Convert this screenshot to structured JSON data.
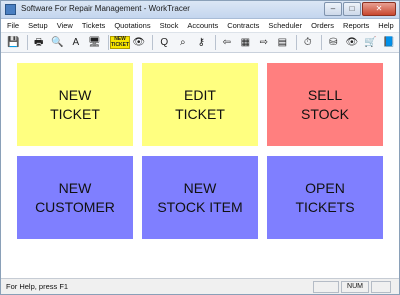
{
  "window": {
    "title": "Software For Repair Management - WorkTracer",
    "min_glyph": "–",
    "max_glyph": "□",
    "close_glyph": "✕"
  },
  "menu": [
    {
      "label": "File"
    },
    {
      "label": "Setup"
    },
    {
      "label": "View"
    },
    {
      "label": "Tickets"
    },
    {
      "label": "Quotations"
    },
    {
      "label": "Stock"
    },
    {
      "label": "Accounts"
    },
    {
      "label": "Contracts"
    },
    {
      "label": "Scheduler"
    },
    {
      "label": "Orders"
    },
    {
      "label": "Reports"
    },
    {
      "label": "Help"
    }
  ],
  "toolbar": {
    "save_glyph": "💾",
    "print_glyph": "🖶",
    "preview_glyph": "🔍",
    "font_glyph": "A",
    "screen_glyph": "🖥",
    "new_ticket_label": "NEW TICKET",
    "binoculars_glyph": "👁",
    "find_glyph": "Q",
    "search_glyph": "⌕",
    "key_glyph": "⚷",
    "back_glyph": "⇦",
    "doc_glyph": "▦",
    "forward_glyph": "⇨",
    "calc_glyph": "▤",
    "clock_glyph": "⏱",
    "db_glyph": "⛁",
    "binoculars2_glyph": "👁",
    "cart_glyph": "🛒",
    "book_glyph": "📘"
  },
  "tiles": {
    "new_ticket": "NEW\nTICKET",
    "edit_ticket": "EDIT\nTICKET",
    "sell_stock": "SELL\nSTOCK",
    "new_customer": "NEW\nCUSTOMER",
    "new_stock_item": "NEW\nSTOCK ITEM",
    "open_tickets": "OPEN\nTICKETS"
  },
  "colors": {
    "tile_yellow": "#ffff80",
    "tile_red": "#ff7f7f",
    "tile_blue": "#7f7fff"
  },
  "status": {
    "help_text": "For Help, press F1",
    "pane_num": "NUM"
  }
}
